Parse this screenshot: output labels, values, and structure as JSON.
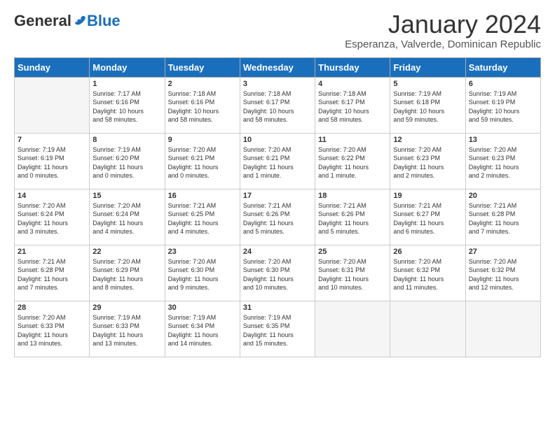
{
  "logo": {
    "general": "General",
    "blue": "Blue",
    "tagline": ""
  },
  "title": "January 2024",
  "subtitle": "Esperanza, Valverde, Dominican Republic",
  "days_of_week": [
    "Sunday",
    "Monday",
    "Tuesday",
    "Wednesday",
    "Thursday",
    "Friday",
    "Saturday"
  ],
  "weeks": [
    [
      {
        "day": "",
        "info": ""
      },
      {
        "day": "1",
        "info": "Sunrise: 7:17 AM\nSunset: 6:16 PM\nDaylight: 10 hours\nand 58 minutes."
      },
      {
        "day": "2",
        "info": "Sunrise: 7:18 AM\nSunset: 6:16 PM\nDaylight: 10 hours\nand 58 minutes."
      },
      {
        "day": "3",
        "info": "Sunrise: 7:18 AM\nSunset: 6:17 PM\nDaylight: 10 hours\nand 58 minutes."
      },
      {
        "day": "4",
        "info": "Sunrise: 7:18 AM\nSunset: 6:17 PM\nDaylight: 10 hours\nand 58 minutes."
      },
      {
        "day": "5",
        "info": "Sunrise: 7:19 AM\nSunset: 6:18 PM\nDaylight: 10 hours\nand 59 minutes."
      },
      {
        "day": "6",
        "info": "Sunrise: 7:19 AM\nSunset: 6:19 PM\nDaylight: 10 hours\nand 59 minutes."
      }
    ],
    [
      {
        "day": "7",
        "info": "Sunrise: 7:19 AM\nSunset: 6:19 PM\nDaylight: 11 hours\nand 0 minutes."
      },
      {
        "day": "8",
        "info": "Sunrise: 7:19 AM\nSunset: 6:20 PM\nDaylight: 11 hours\nand 0 minutes."
      },
      {
        "day": "9",
        "info": "Sunrise: 7:20 AM\nSunset: 6:21 PM\nDaylight: 11 hours\nand 0 minutes."
      },
      {
        "day": "10",
        "info": "Sunrise: 7:20 AM\nSunset: 6:21 PM\nDaylight: 11 hours\nand 1 minute."
      },
      {
        "day": "11",
        "info": "Sunrise: 7:20 AM\nSunset: 6:22 PM\nDaylight: 11 hours\nand 1 minute."
      },
      {
        "day": "12",
        "info": "Sunrise: 7:20 AM\nSunset: 6:23 PM\nDaylight: 11 hours\nand 2 minutes."
      },
      {
        "day": "13",
        "info": "Sunrise: 7:20 AM\nSunset: 6:23 PM\nDaylight: 11 hours\nand 2 minutes."
      }
    ],
    [
      {
        "day": "14",
        "info": "Sunrise: 7:20 AM\nSunset: 6:24 PM\nDaylight: 11 hours\nand 3 minutes."
      },
      {
        "day": "15",
        "info": "Sunrise: 7:20 AM\nSunset: 6:24 PM\nDaylight: 11 hours\nand 4 minutes."
      },
      {
        "day": "16",
        "info": "Sunrise: 7:21 AM\nSunset: 6:25 PM\nDaylight: 11 hours\nand 4 minutes."
      },
      {
        "day": "17",
        "info": "Sunrise: 7:21 AM\nSunset: 6:26 PM\nDaylight: 11 hours\nand 5 minutes."
      },
      {
        "day": "18",
        "info": "Sunrise: 7:21 AM\nSunset: 6:26 PM\nDaylight: 11 hours\nand 5 minutes."
      },
      {
        "day": "19",
        "info": "Sunrise: 7:21 AM\nSunset: 6:27 PM\nDaylight: 11 hours\nand 6 minutes."
      },
      {
        "day": "20",
        "info": "Sunrise: 7:21 AM\nSunset: 6:28 PM\nDaylight: 11 hours\nand 7 minutes."
      }
    ],
    [
      {
        "day": "21",
        "info": "Sunrise: 7:21 AM\nSunset: 6:28 PM\nDaylight: 11 hours\nand 7 minutes."
      },
      {
        "day": "22",
        "info": "Sunrise: 7:20 AM\nSunset: 6:29 PM\nDaylight: 11 hours\nand 8 minutes."
      },
      {
        "day": "23",
        "info": "Sunrise: 7:20 AM\nSunset: 6:30 PM\nDaylight: 11 hours\nand 9 minutes."
      },
      {
        "day": "24",
        "info": "Sunrise: 7:20 AM\nSunset: 6:30 PM\nDaylight: 11 hours\nand 10 minutes."
      },
      {
        "day": "25",
        "info": "Sunrise: 7:20 AM\nSunset: 6:31 PM\nDaylight: 11 hours\nand 10 minutes."
      },
      {
        "day": "26",
        "info": "Sunrise: 7:20 AM\nSunset: 6:32 PM\nDaylight: 11 hours\nand 11 minutes."
      },
      {
        "day": "27",
        "info": "Sunrise: 7:20 AM\nSunset: 6:32 PM\nDaylight: 11 hours\nand 12 minutes."
      }
    ],
    [
      {
        "day": "28",
        "info": "Sunrise: 7:20 AM\nSunset: 6:33 PM\nDaylight: 11 hours\nand 13 minutes."
      },
      {
        "day": "29",
        "info": "Sunrise: 7:19 AM\nSunset: 6:33 PM\nDaylight: 11 hours\nand 13 minutes."
      },
      {
        "day": "30",
        "info": "Sunrise: 7:19 AM\nSunset: 6:34 PM\nDaylight: 11 hours\nand 14 minutes."
      },
      {
        "day": "31",
        "info": "Sunrise: 7:19 AM\nSunset: 6:35 PM\nDaylight: 11 hours\nand 15 minutes."
      },
      {
        "day": "",
        "info": ""
      },
      {
        "day": "",
        "info": ""
      },
      {
        "day": "",
        "info": ""
      }
    ]
  ]
}
